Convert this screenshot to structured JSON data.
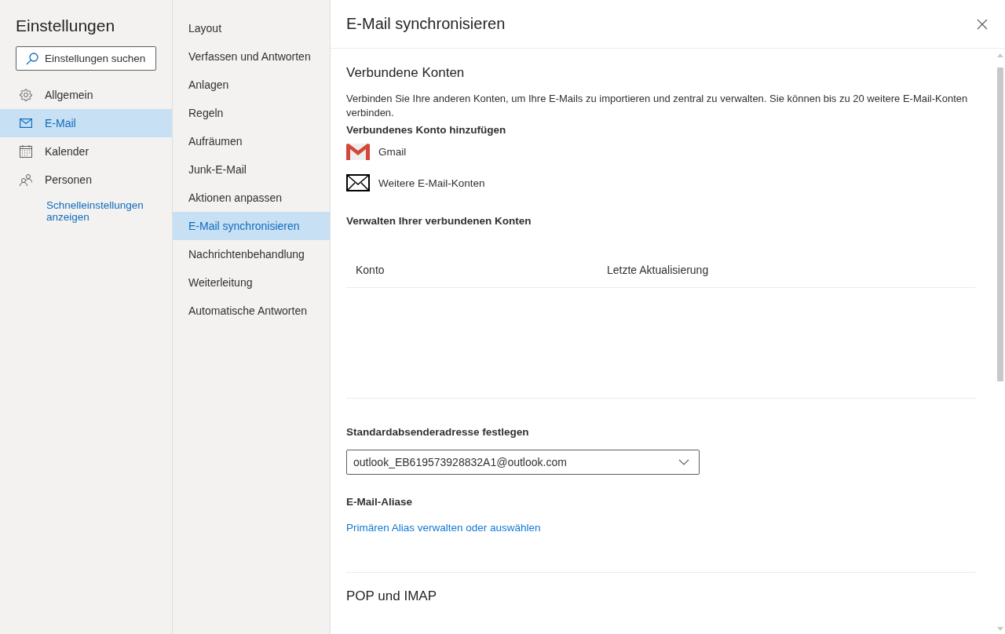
{
  "sidebar": {
    "title": "Einstellungen",
    "search": {
      "placeholder": "Einstellungen suchen"
    },
    "items": [
      {
        "kind": "gear",
        "label": "Allgemein",
        "selected": false
      },
      {
        "kind": "mail",
        "label": "E-Mail",
        "selected": true
      },
      {
        "kind": "calendar",
        "label": "Kalender",
        "selected": false
      },
      {
        "kind": "people",
        "label": "Personen",
        "selected": false
      }
    ],
    "quick_link": "Schnelleinstellungen anzeigen"
  },
  "categories": [
    {
      "label": "Layout",
      "selected": false
    },
    {
      "label": "Verfassen und Antworten",
      "selected": false
    },
    {
      "label": "Anlagen",
      "selected": false
    },
    {
      "label": "Regeln",
      "selected": false
    },
    {
      "label": "Aufräumen",
      "selected": false
    },
    {
      "label": "Junk-E-Mail",
      "selected": false
    },
    {
      "label": "Aktionen anpassen",
      "selected": false
    },
    {
      "label": "E-Mail synchronisieren",
      "selected": true
    },
    {
      "label": "Nachrichtenbehandlung",
      "selected": false
    },
    {
      "label": "Weiterleitung",
      "selected": false
    },
    {
      "label": "Automatische Antworten",
      "selected": false
    }
  ],
  "pane": {
    "title": "E-Mail synchronisieren",
    "connected": {
      "heading": "Verbundene Konten",
      "description": "Verbinden Sie Ihre anderen Konten, um Ihre E-Mails zu importieren und zentral zu verwalten. Sie können bis zu 20 weitere E-Mail-Konten verbinden.",
      "add_label": "Verbundenes Konto hinzufügen",
      "providers": [
        {
          "kind": "gmail",
          "label": "Gmail"
        },
        {
          "kind": "other",
          "label": "Weitere E-Mail-Konten"
        }
      ]
    },
    "manage": {
      "heading": "Verwalten Ihrer verbundenen Konten",
      "columns": [
        "Konto",
        "Letzte Aktualisierung"
      ]
    },
    "default_sender": {
      "label": "Standardabsenderadresse festlegen",
      "value": "outlook_EB619573928832A1@outlook.com"
    },
    "aliases": {
      "label": "E-Mail-Aliase",
      "link": "Primären Alias verwalten oder auswählen"
    },
    "next_heading": "POP und IMAP"
  }
}
